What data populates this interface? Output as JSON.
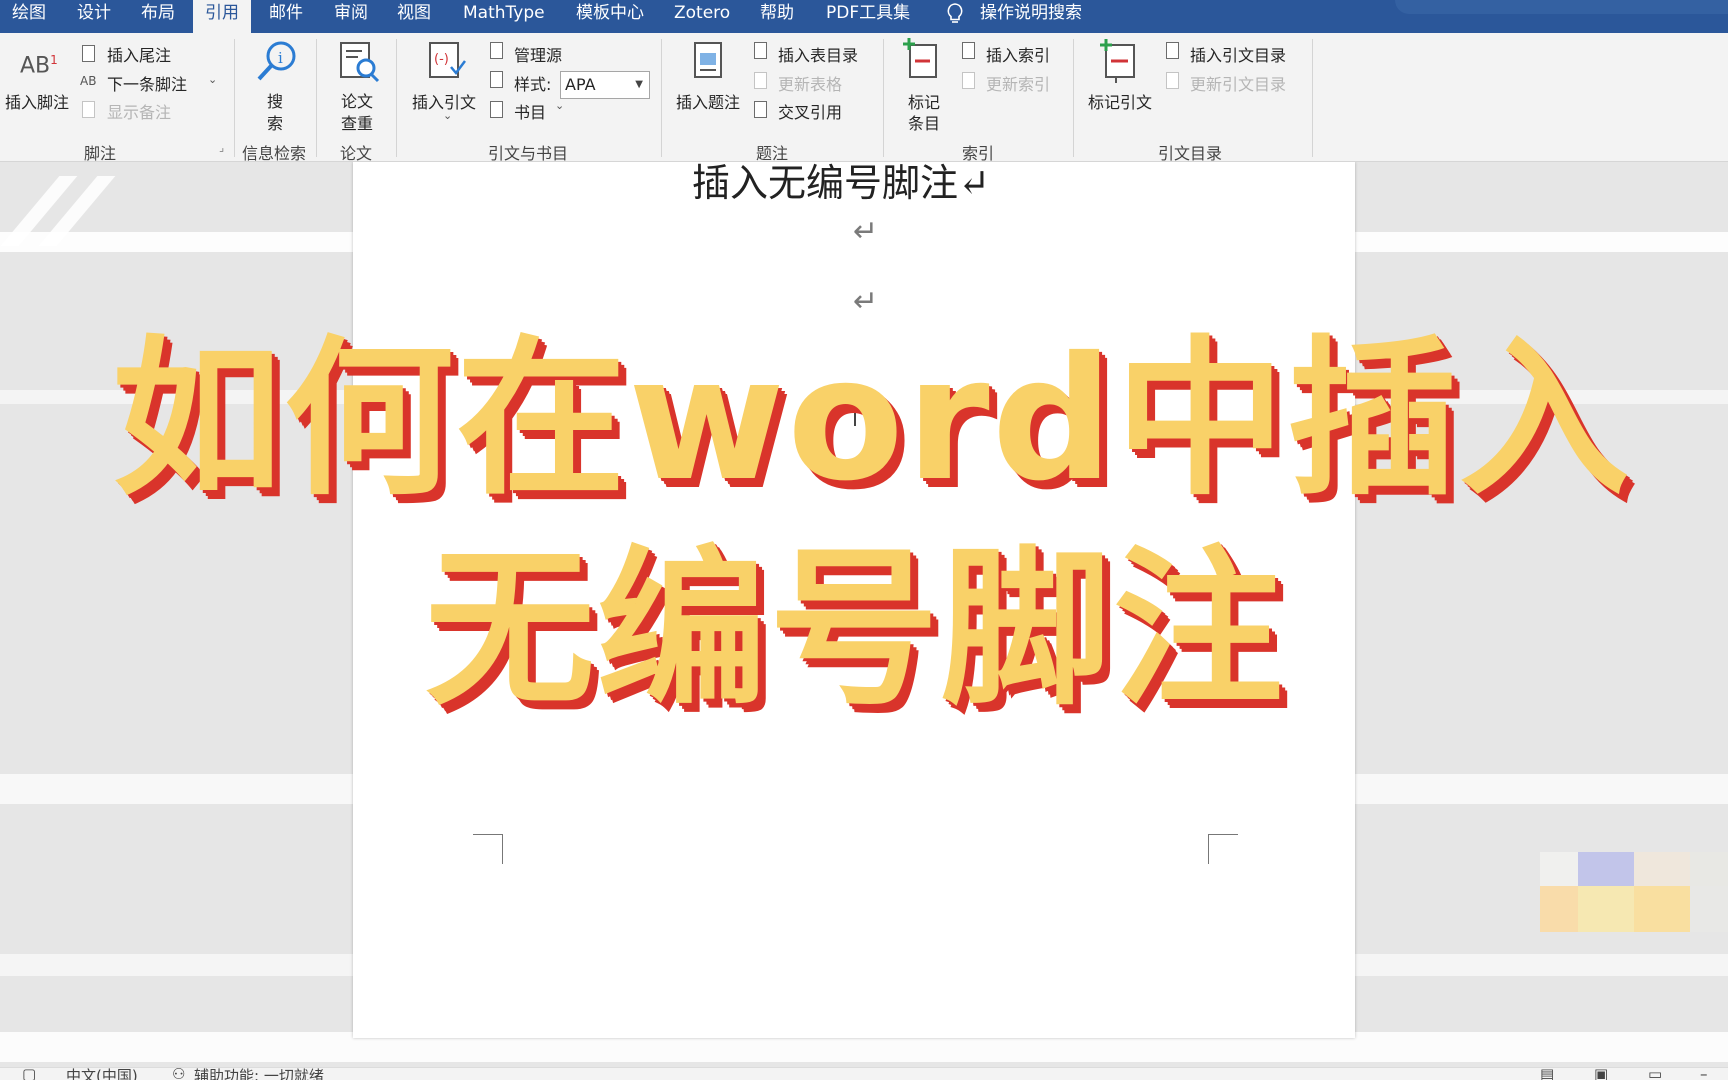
{
  "tabs": [
    {
      "label": "绘图",
      "active": false
    },
    {
      "label": "设计",
      "active": false
    },
    {
      "label": "布局",
      "active": false
    },
    {
      "label": "引用",
      "active": true
    },
    {
      "label": "邮件",
      "active": false
    },
    {
      "label": "审阅",
      "active": false
    },
    {
      "label": "视图",
      "active": false
    },
    {
      "label": "MathType",
      "active": false
    },
    {
      "label": "模板中心",
      "active": false
    },
    {
      "label": "Zotero",
      "active": false
    },
    {
      "label": "帮助",
      "active": false
    },
    {
      "label": "PDF工具集",
      "active": false
    },
    {
      "label": "操作说明搜索",
      "active": false
    }
  ],
  "ribbon": {
    "footnotes": {
      "insert_footnote": {
        "label": "插入脚注",
        "icon_text": "AB",
        "icon_super": "1"
      },
      "insert_endnote": "插入尾注",
      "next_footnote": "下一条脚注",
      "next_icon_text": "AB",
      "show_notes": "显示备注",
      "group_label": "脚注"
    },
    "research": {
      "search_label_1": "搜",
      "search_label_2": "索",
      "group_label": "信息检索"
    },
    "paper": {
      "check_label_1": "论文",
      "check_label_2": "查重",
      "group_label": "论文"
    },
    "citations": {
      "insert_citation": "插入引文",
      "manage_sources": "管理源",
      "style_label": "样式:",
      "style_value": "APA",
      "bibliography": "书目",
      "group_label": "引文与书目"
    },
    "captions": {
      "insert_caption": "插入题注",
      "insert_table_of_figures": "插入表目录",
      "update_table": "更新表格",
      "cross_reference": "交叉引用",
      "group_label": "题注"
    },
    "index": {
      "mark_entry_1": "标记",
      "mark_entry_2": "条目",
      "insert_index": "插入索引",
      "update_index": "更新索引",
      "group_label": "索引"
    },
    "toa": {
      "mark_citation": "标记引文",
      "insert_toa": "插入引文目录",
      "update_toa": "更新引文目录",
      "group_label": "引文目录"
    }
  },
  "document": {
    "heading_text": "插入无编号脚注↵",
    "paragraph_mark": "↵"
  },
  "overlay": {
    "line1": "如何在word中插入",
    "line2": "无编号脚注"
  },
  "status": {
    "language": "中文(中国)",
    "accessibility": "辅助功能: 一切就绪"
  },
  "colors": {
    "tabbar": "#2b579a",
    "ribbon": "#f3f3f3",
    "overlay_fill": "#f9d168",
    "overlay_shadow": "#d9342b"
  }
}
